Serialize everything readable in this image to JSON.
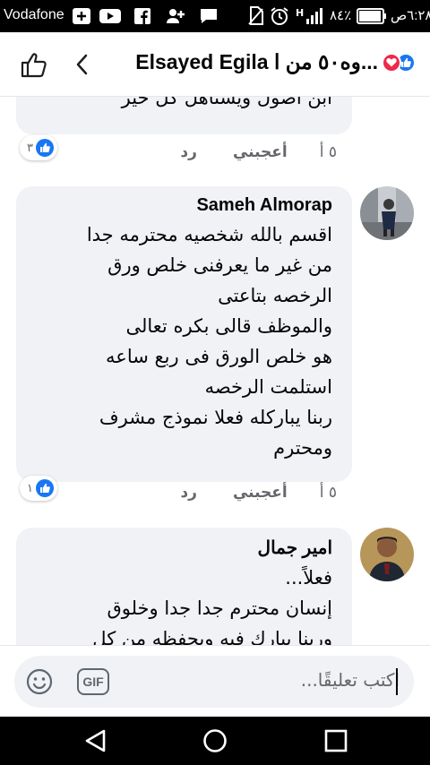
{
  "status_bar": {
    "carrier": "Vodafone",
    "battery_percent": "٨٤٪",
    "time": "٦:٢٨ص",
    "network": "H"
  },
  "header": {
    "title": "Elsayed Egila وه٥٠ من ا...",
    "reactions": [
      "like-icon",
      "love-icon"
    ]
  },
  "comments": [
    {
      "author": "",
      "body": "ابن أصول ويستاهل كل خير",
      "reaction_count": "٣",
      "time": "٥ أ",
      "like_label": "أعجبني",
      "reply_label": "رد"
    },
    {
      "author": "Sameh Almorap",
      "body": "اقسم بالله شخصيه محترمه جدا\nمن غير ما يعرفنى خلص ورق\nالرخصه بتاعتى\nوالموظف قالى بكره تعالى\nهو خلص الورق فى ربع ساعه\nاستلمت الرخصه\nربنا يباركله فعلا نموذج مشرف\nومحترم",
      "reaction_count": "١",
      "time": "٥ أ",
      "like_label": "أعجبني",
      "reply_label": "رد"
    },
    {
      "author": "امير جمال",
      "body": "فعلاً...\nإنسان محترم جدا جدا وخلوق\nوربنا يبارك فيه ويحفظه من كل",
      "reaction_count": "",
      "time": "",
      "like_label": "",
      "reply_label": ""
    }
  ],
  "composer": {
    "placeholder": "اكتب تعليقًا...",
    "gif_label": "GIF"
  },
  "colors": {
    "accent": "#1877f2",
    "bubble": "#f0f2f5",
    "love": "#f02849",
    "muted": "#65676b"
  }
}
